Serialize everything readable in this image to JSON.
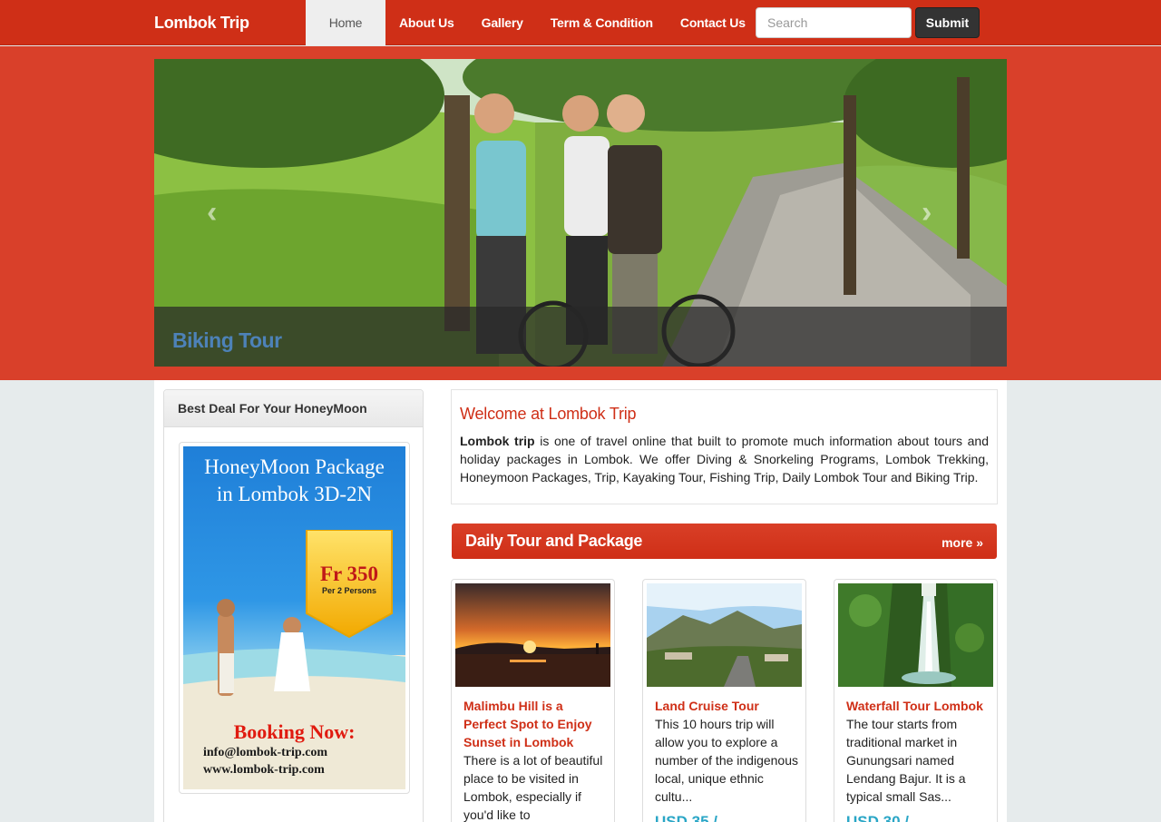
{
  "navbar": {
    "brand": "Lombok Trip",
    "items": [
      {
        "label": "Home",
        "active": true
      },
      {
        "label": "About Us"
      },
      {
        "label": "Gallery"
      },
      {
        "label": "Term & Condition"
      },
      {
        "label": "Contact Us"
      }
    ],
    "search_placeholder": "Search",
    "submit_label": "Submit"
  },
  "carousel": {
    "caption": "Biking Tour",
    "prev_icon": "‹",
    "next_icon": "›"
  },
  "sidebar": {
    "heading": "Best Deal For Your HoneyMoon",
    "promo": {
      "title_line1": "HoneyMoon Package",
      "title_line2": "in Lombok 3D-2N",
      "price": "Fr 350",
      "per": "Per 2 Persons",
      "booking": "Booking Now:",
      "email": "info@lombok-trip.com",
      "website": "www.lombok-trip.com"
    }
  },
  "welcome": {
    "title": "Welcome at Lombok Trip",
    "lead": "Lombok trip",
    "body": " is one of travel online that built to promote much information about tours and holiday packages in Lombok. We offer Diving & Snorkeling Programs, Lombok Trekking, Honeymoon Packages, Trip, Kayaking Tour, Fishing Trip, Daily Lombok Tour and Biking Trip."
  },
  "daily": {
    "title": "Daily Tour and Package",
    "more": "more »"
  },
  "tours": [
    {
      "title": "Malimbu Hill is a Perfect Spot to Enjoy Sunset in Lombok",
      "desc": "There is a lot of beautiful place to be visited in Lombok, especially if you'd like to",
      "price": ""
    },
    {
      "title": "Land Cruise Tour",
      "desc": "This 10 hours trip will allow you to explore a number of the indigenous local, unique ethnic cultu...",
      "price": "USD 35 /"
    },
    {
      "title": "Waterfall Tour Lombok",
      "desc": "The tour starts from traditional market in Gunungsari named Lendang Bajur. It is a typical small Sas...",
      "price": "USD 30 /"
    }
  ],
  "colors": {
    "brand_red": "#cf2f17",
    "hero_red": "#d9402a",
    "price_teal": "#2aa6c6"
  }
}
